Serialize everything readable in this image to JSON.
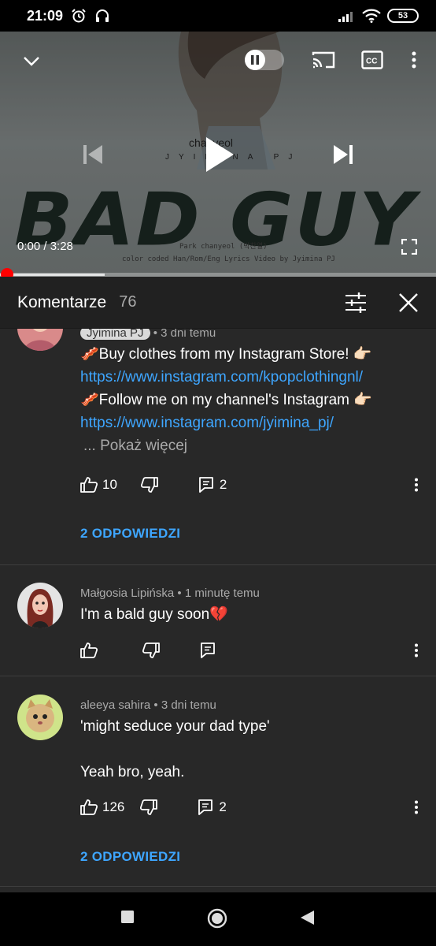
{
  "status_bar": {
    "time": "21:09",
    "battery": "53"
  },
  "player": {
    "title_art": "BAD GUY",
    "artist_art": "chanyeol",
    "channel_art": "JYIMINA PJ",
    "caption_line1": "Park chanyeol (박찬열)",
    "caption_line2": "color coded Han/Rom/Eng Lyrics Video by Jyimina PJ",
    "time_current": "0:00",
    "time_total": "3:28",
    "time_display": "0:00 / 3:28",
    "progress_fraction": 0.0,
    "buffered_fraction": 0.24
  },
  "comments_header": {
    "title": "Komentarze",
    "count": "76"
  },
  "comments": [
    {
      "author": "Jyimina PJ",
      "time": "• 3 dni temu",
      "lines": [
        "🥓Buy clothes from my Instagram Store! 👉🏻",
        "https://www.instagram.com/kpopclothingnl/",
        "🥓Follow me on my channel's Instagram 👉🏻",
        "https://www.instagram.com/jyimina_pj/"
      ],
      "show_more": "... Pokaż więcej",
      "likes": "10",
      "replies_count": "2",
      "replies_label": "2 ODPOWIEDZI"
    },
    {
      "author": "Małgosia Lipińska",
      "time": "• 1 minutę temu",
      "lines": [
        "I'm a bald guy soon💔"
      ],
      "likes": "",
      "replies_count": ""
    },
    {
      "author": "aleeya sahira",
      "time": "• 3 dni temu",
      "lines": [
        "'might seduce your dad type'",
        "",
        "Yeah bro, yeah."
      ],
      "likes": "126",
      "replies_count": "2",
      "replies_label": "2 ODPOWIEDZI"
    }
  ],
  "icons": {
    "collapse": "chevron-down-icon",
    "cast": "cast-icon",
    "captions": "cc-icon",
    "more": "kebab-icon",
    "previous": "skip-previous-icon",
    "play": "play-icon",
    "next": "skip-next-icon",
    "fullscreen": "fullscreen-icon",
    "sort": "sort-icon",
    "close": "close-icon",
    "like": "thumb-up-icon",
    "dislike": "thumb-down-icon",
    "reply": "reply-icon"
  },
  "colors": {
    "accent_link": "#3ea6ff",
    "progress_red": "#ff0000",
    "background": "#282828"
  }
}
